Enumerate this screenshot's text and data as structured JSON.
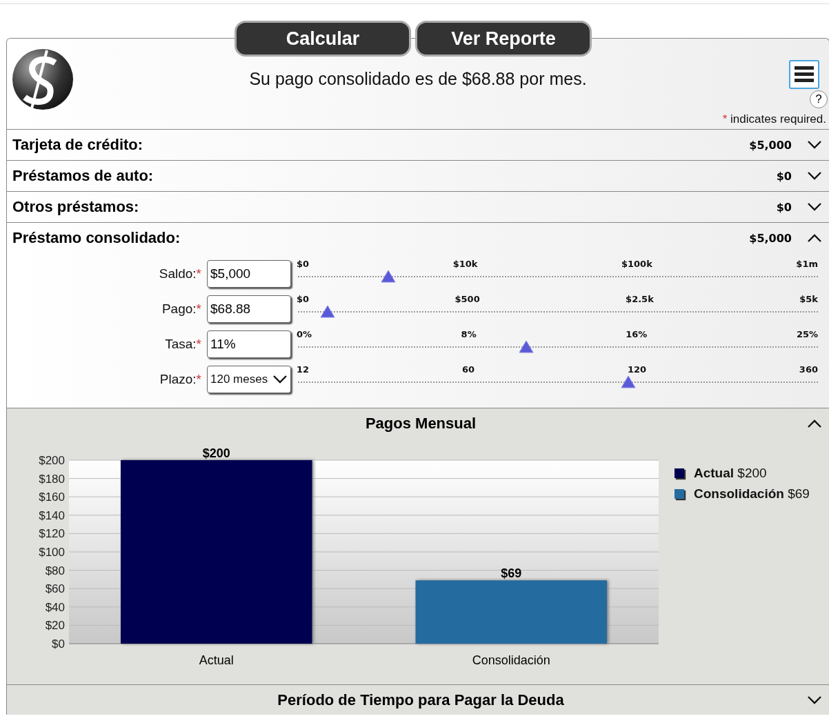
{
  "toolbar": {
    "buttons": [
      "Calcular",
      "Ver Reporte"
    ]
  },
  "summary": "Su pago consolidado es de $68.88 por mes.",
  "help": "?",
  "required_note": {
    "mark": "*",
    "text": "indicates required."
  },
  "sections": [
    {
      "label": "Tarjeta de crédito:",
      "value": "$5,000",
      "expanded": false
    },
    {
      "label": "Préstamos de auto:",
      "value": "$0",
      "expanded": false
    },
    {
      "label": "Otros préstamos:",
      "value": "$0",
      "expanded": false
    },
    {
      "label": "Préstamo consolidado:",
      "value": "$5,000",
      "expanded": true
    }
  ],
  "fields": [
    {
      "label": "Saldo:",
      "mark": "*",
      "kind": "text",
      "value": "$5,000",
      "ticks": [
        "$0",
        "$10k",
        "$100k",
        "$1m"
      ],
      "level": 0.176
    },
    {
      "label": "Pago:",
      "mark": "*",
      "kind": "text",
      "value": "$68.88",
      "ticks": [
        "$0",
        "$500",
        "$2.5k",
        "$5k"
      ],
      "level": 0.06
    },
    {
      "label": "Tasa:",
      "mark": "*",
      "kind": "text",
      "value": "11%",
      "ticks": [
        "0%",
        "8%",
        "16%",
        "25%"
      ],
      "level": 0.44
    },
    {
      "label": "Plazo:",
      "mark": "*",
      "kind": "select",
      "value": "120 meses",
      "ticks": [
        "12",
        "60",
        "120",
        "360"
      ],
      "level": 0.636
    }
  ],
  "panels": [
    {
      "title": "Pagos Mensual",
      "expanded": true,
      "chart_data": {
        "type": "bar",
        "categories": [
          "Actual",
          "Consolidación"
        ],
        "stacked": true,
        "series": [
          {
            "name": "Actual",
            "color": "#000050",
            "values": [
              200,
              null
            ]
          },
          {
            "name": "Consolidación",
            "color": "#246ca0",
            "values": [
              null,
              69
            ]
          }
        ],
        "ylim": [
          0,
          200
        ],
        "grid": true,
        "yticks": [
          {
            "value": 0,
            "label": "$0"
          },
          {
            "value": 20,
            "label": "$20"
          },
          {
            "value": 40,
            "label": "$40"
          },
          {
            "value": 60,
            "label": "$60"
          },
          {
            "value": 80,
            "label": "$80"
          },
          {
            "value": 100,
            "label": "$100"
          },
          {
            "value": 120,
            "label": "$120"
          },
          {
            "value": 140,
            "label": "$140"
          },
          {
            "value": 160,
            "label": "$160"
          },
          {
            "value": 180,
            "label": "$180"
          },
          {
            "value": 200,
            "label": "$200"
          }
        ],
        "value_labels": [
          "$200",
          "$69"
        ]
      },
      "legend": [
        {
          "value": "$200"
        },
        {
          "value": "$69"
        }
      ]
    },
    {
      "title": "Período de Tiempo para Pagar la Deuda",
      "expanded": false
    }
  ]
}
